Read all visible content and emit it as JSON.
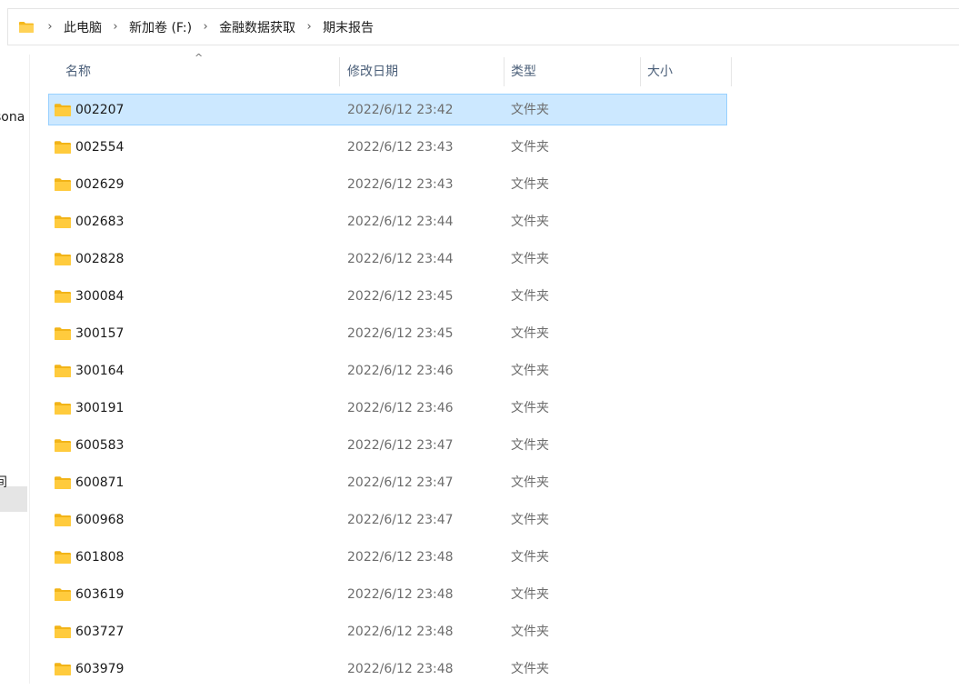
{
  "breadcrumb": {
    "icon": "folder-icon",
    "items": [
      "此电脑",
      "新加卷 (F:)",
      "金融数据获取",
      "期末报告"
    ]
  },
  "nav": {
    "item_partial_1": "sona",
    "item_partial_2": "间"
  },
  "columns": {
    "name": "名称",
    "modified": "修改日期",
    "type": "类型",
    "size": "大小",
    "sort_indicator": "^"
  },
  "colors": {
    "selected_bg": "#cce8ff",
    "selected_border": "#99d1ff",
    "folder_yellow": "#ffcb3d"
  },
  "files": [
    {
      "name": "002207",
      "modified": "2022/6/12 23:42",
      "type": "文件夹",
      "selected": true
    },
    {
      "name": "002554",
      "modified": "2022/6/12 23:43",
      "type": "文件夹"
    },
    {
      "name": "002629",
      "modified": "2022/6/12 23:43",
      "type": "文件夹"
    },
    {
      "name": "002683",
      "modified": "2022/6/12 23:44",
      "type": "文件夹"
    },
    {
      "name": "002828",
      "modified": "2022/6/12 23:44",
      "type": "文件夹"
    },
    {
      "name": "300084",
      "modified": "2022/6/12 23:45",
      "type": "文件夹"
    },
    {
      "name": "300157",
      "modified": "2022/6/12 23:45",
      "type": "文件夹"
    },
    {
      "name": "300164",
      "modified": "2022/6/12 23:46",
      "type": "文件夹"
    },
    {
      "name": "300191",
      "modified": "2022/6/12 23:46",
      "type": "文件夹"
    },
    {
      "name": "600583",
      "modified": "2022/6/12 23:47",
      "type": "文件夹"
    },
    {
      "name": "600871",
      "modified": "2022/6/12 23:47",
      "type": "文件夹"
    },
    {
      "name": "600968",
      "modified": "2022/6/12 23:47",
      "type": "文件夹"
    },
    {
      "name": "601808",
      "modified": "2022/6/12 23:48",
      "type": "文件夹"
    },
    {
      "name": "603619",
      "modified": "2022/6/12 23:48",
      "type": "文件夹"
    },
    {
      "name": "603727",
      "modified": "2022/6/12 23:48",
      "type": "文件夹"
    },
    {
      "name": "603979",
      "modified": "2022/6/12 23:48",
      "type": "文件夹"
    }
  ]
}
